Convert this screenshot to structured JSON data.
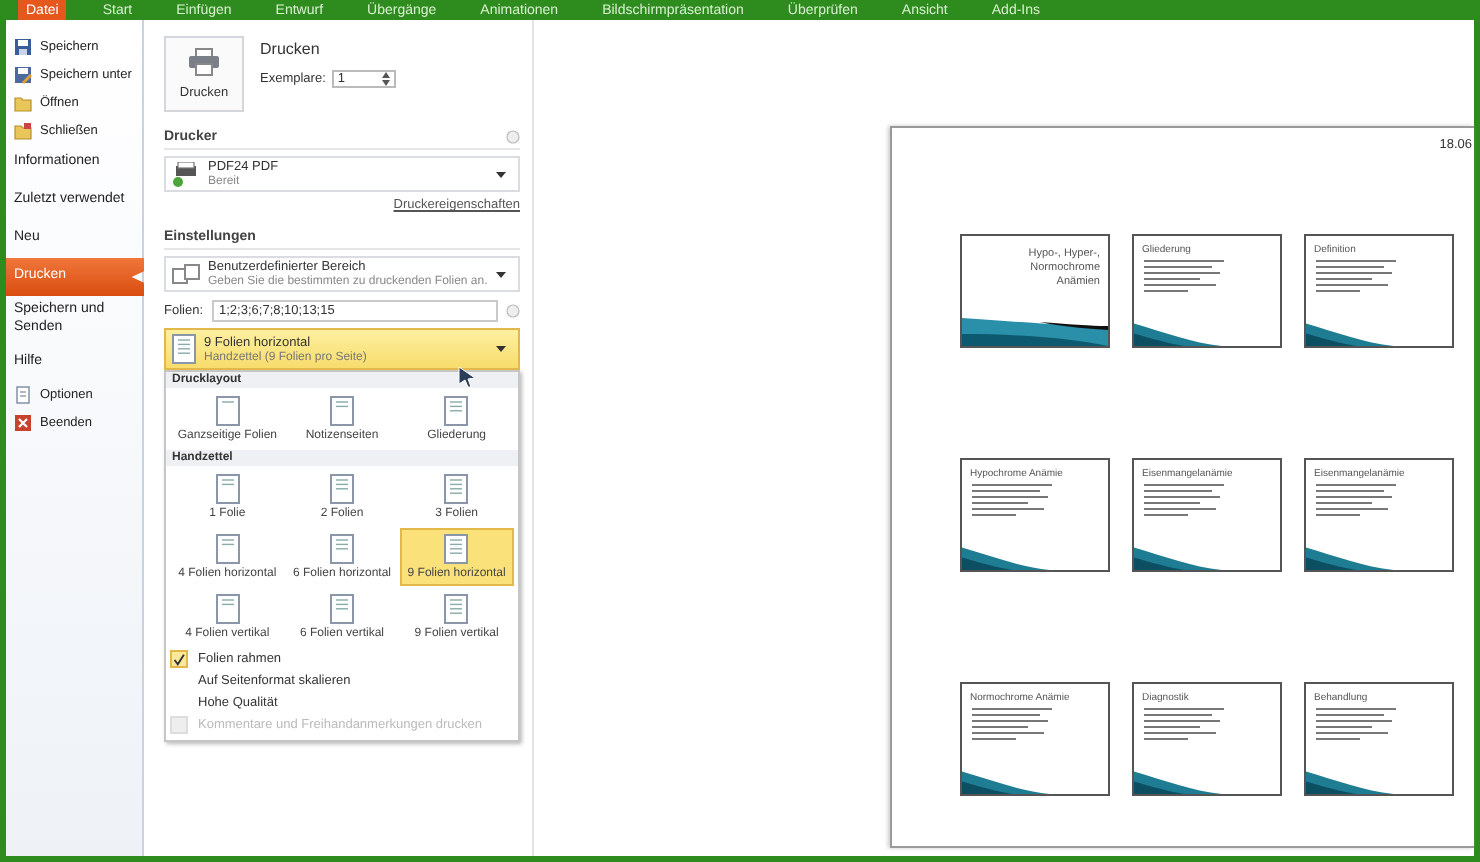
{
  "ribbon_tabs": [
    {
      "label": "Datei",
      "selected": true
    },
    {
      "label": "Start",
      "selected": false
    },
    {
      "label": "Einfügen",
      "selected": false
    },
    {
      "label": "Entwurf",
      "selected": false
    },
    {
      "label": "Übergänge",
      "selected": false
    },
    {
      "label": "Animationen",
      "selected": false
    },
    {
      "label": "Bildschirmpräsentation",
      "selected": false
    },
    {
      "label": "Überprüfen",
      "selected": false
    },
    {
      "label": "Ansicht",
      "selected": false
    },
    {
      "label": "Add-Ins",
      "selected": false
    }
  ],
  "sidebar": {
    "items": [
      {
        "label": "Speichern",
        "kind": "command",
        "selected": false
      },
      {
        "label": "Speichern unter",
        "kind": "command",
        "selected": false
      },
      {
        "label": "Öffnen",
        "kind": "command",
        "selected": false
      },
      {
        "label": "Schließen",
        "kind": "command",
        "selected": false
      },
      {
        "label": "Informationen",
        "kind": "section",
        "selected": false
      },
      {
        "label": "Zuletzt verwendet",
        "kind": "section",
        "selected": false
      },
      {
        "label": "Neu",
        "kind": "section",
        "selected": false
      },
      {
        "label": "Drucken",
        "kind": "section",
        "selected": true
      },
      {
        "label": "Speichern und Senden",
        "kind": "section",
        "selected": false
      },
      {
        "label": "Hilfe",
        "kind": "section",
        "selected": false
      },
      {
        "label": "Optionen",
        "kind": "command",
        "selected": false
      },
      {
        "label": "Beenden",
        "kind": "command",
        "selected": false
      }
    ]
  },
  "print": {
    "title": "Drucken",
    "button": "Drucken",
    "copies_label": "Exemplare:",
    "copies": "1",
    "printer": {
      "heading": "Drucker",
      "name": "PDF24 PDF",
      "status": "Bereit",
      "link": "Druckereigenschaften"
    },
    "settings": {
      "heading": "Einstellungen",
      "range": {
        "title": "Benutzerdefinierter Bereich",
        "description": "Geben Sie die bestimmten zu druckenden Folien an."
      },
      "slides_label": "Folien:",
      "slides_value": "1;2;3;6;7;8;10;13;15",
      "layout": {
        "title": "9 Folien horizontal",
        "description": "Handzettel (9 Folien pro Seite)",
        "expanded": true
      }
    },
    "menu": {
      "sections": [
        {
          "heading": "Drucklayout",
          "options": [
            {
              "label": "Ganzseitige Folien",
              "selected": false
            },
            {
              "label": "Notizenseiten",
              "selected": false
            },
            {
              "label": "Gliederung",
              "selected": false
            }
          ]
        },
        {
          "heading": "Handzettel",
          "options": [
            {
              "label": "1 Folie",
              "selected": false
            },
            {
              "label": "2 Folien",
              "selected": false
            },
            {
              "label": "3 Folien",
              "selected": false
            },
            {
              "label": "4 Folien horizontal",
              "selected": false
            },
            {
              "label": "6 Folien horizontal",
              "selected": false
            },
            {
              "label": "9 Folien horizontal",
              "selected": true
            },
            {
              "label": "4 Folien vertikal",
              "selected": false
            },
            {
              "label": "6 Folien vertikal",
              "selected": false
            },
            {
              "label": "9 Folien vertikal",
              "selected": false
            }
          ]
        }
      ],
      "checks": [
        {
          "label": "Folien rahmen",
          "checked": true,
          "disabled": false
        },
        {
          "label": "Auf Seitenformat skalieren",
          "checked": false,
          "disabled": false
        },
        {
          "label": "Hohe Qualität",
          "checked": false,
          "disabled": false
        },
        {
          "label": "Kommentare und Freihandanmerkungen drucken",
          "checked": false,
          "disabled": true
        }
      ]
    }
  },
  "preview": {
    "date": "18.06",
    "slides": [
      {
        "kind": "title",
        "title": "Hypo-, Hyper-, Normochrome Anämien"
      },
      {
        "kind": "content",
        "title": "Gliederung"
      },
      {
        "kind": "content",
        "title": "Definition"
      },
      {
        "kind": "content",
        "title": "Hypochrome Anämie"
      },
      {
        "kind": "content",
        "title": "Eisenmangelanämie"
      },
      {
        "kind": "content",
        "title": "Eisenmangelanämie"
      },
      {
        "kind": "content",
        "title": "Normochrome Anämie"
      },
      {
        "kind": "content",
        "title": "Diagnostik"
      },
      {
        "kind": "content",
        "title": "Behandlung"
      }
    ]
  }
}
